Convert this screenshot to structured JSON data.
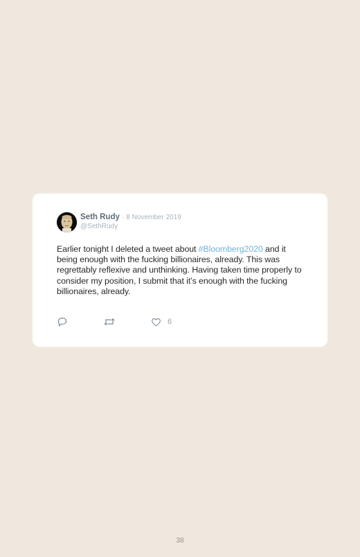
{
  "tweet": {
    "author_name": "Seth Rudy",
    "separator": "·",
    "date": "8 November 2019",
    "handle": "@SethRudy",
    "text_before": "Earlier tonight I deleted a tweet about ",
    "hashtag": "#Bloomberg2020",
    "text_after": " and it being enough with the fucking billionaires, already. This was regrettably reflexive and unthinking. Having taken time properly to consider my position, I submit that it’s enough with the fucking billionaires, already.",
    "like_count": "6"
  },
  "icons": {
    "reply": "reply-icon",
    "retweet": "retweet-icon",
    "like": "heart-icon"
  },
  "colors": {
    "background": "#f0e8de",
    "card": "#ffffff",
    "hashtag": "#6fb3d8",
    "muted": "#aab3bb"
  },
  "page": {
    "number": "38"
  }
}
